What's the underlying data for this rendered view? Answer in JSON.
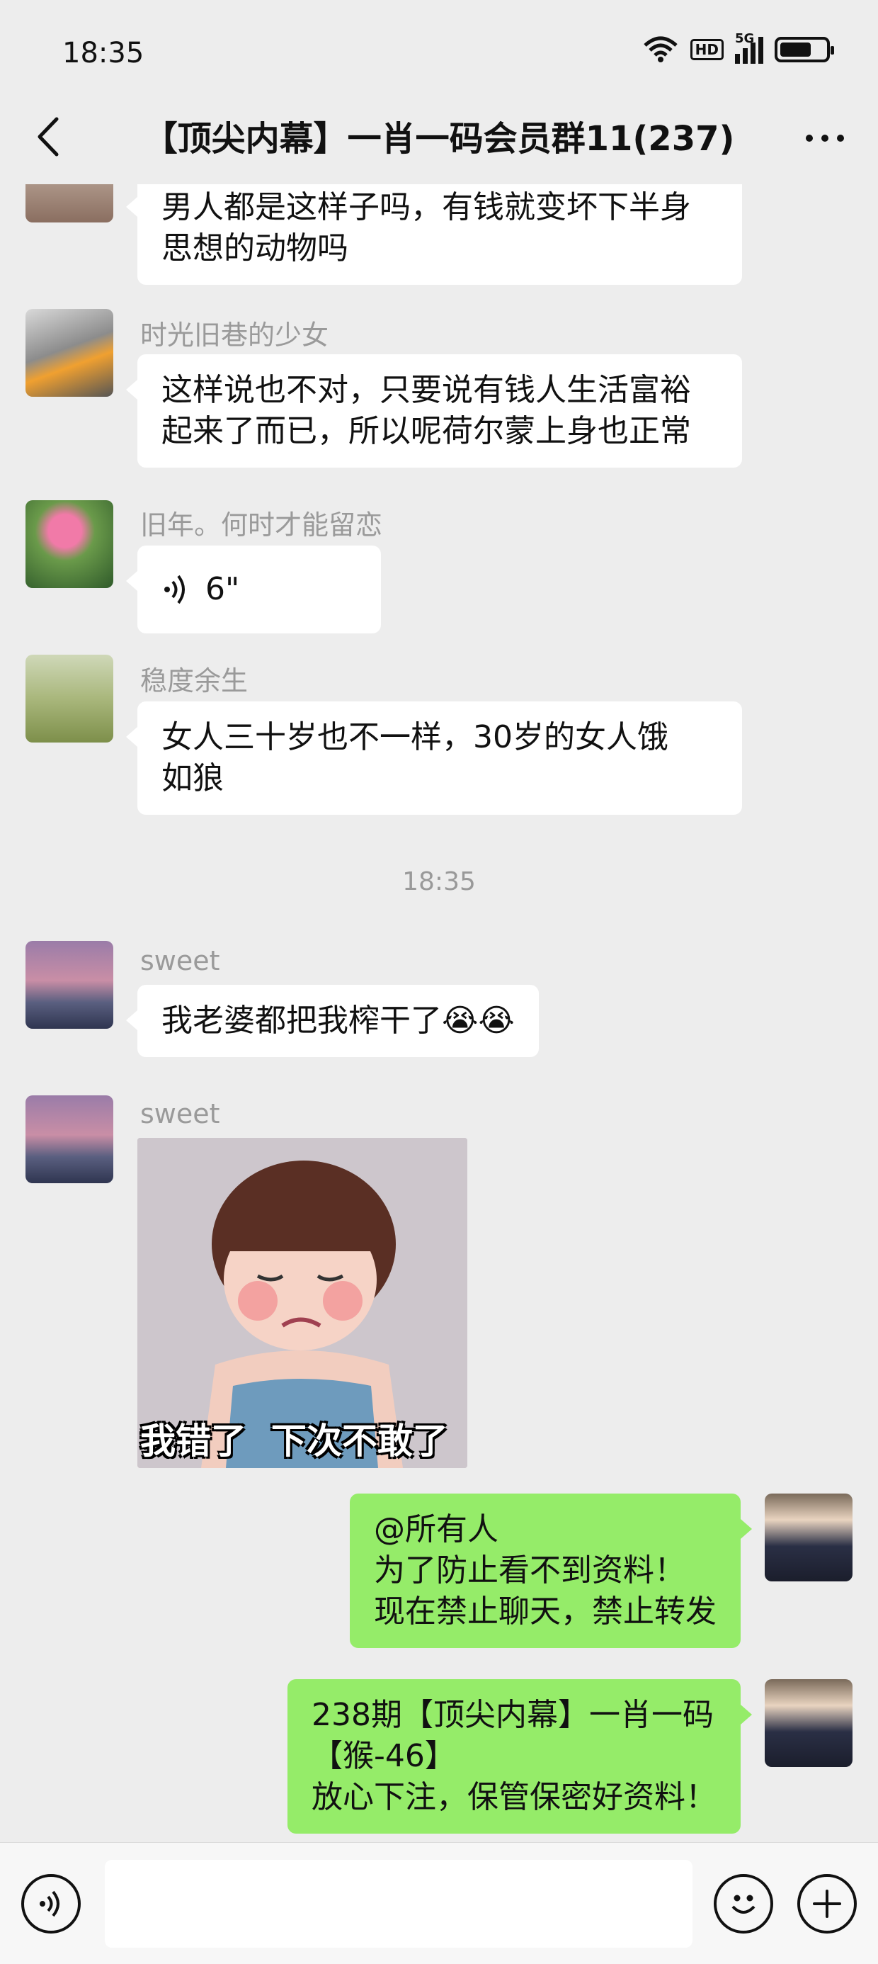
{
  "status_bar": {
    "time": "18:35",
    "hd_label": "HD",
    "network_label": "5G",
    "battery_level": 0.7
  },
  "header": {
    "title": "【顶尖内幕】一肖一码会员群11(237)"
  },
  "messages": [
    {
      "sender": "",
      "text": "男人都是这样子吗，有钱就变坏下半身\n思想的动物吗"
    },
    {
      "sender": "时光旧巷的少女",
      "text": "这样说也不对，只要说有钱人生活富裕\n起来了而已，所以呢荷尔蒙上身也正常"
    },
    {
      "sender": "旧年。何时才能留恋",
      "voice_duration": "6\""
    },
    {
      "sender": "稳度余生",
      "text": "女人三十岁也不一样，30岁的女人饿\n如狼"
    },
    {
      "sender": "sweet",
      "text": "我老婆都把我榨干了😭😭"
    },
    {
      "sender": "sweet",
      "sticker_caption": "我错了  下次不敢了"
    },
    {
      "sender": "me",
      "text": "@所有人\n为了防止看不到资料！\n现在禁止聊天，禁止转发"
    },
    {
      "sender": "me",
      "text": "238期【顶尖内幕】一肖一码\n【猴-46】\n放心下注，保管保密好资料！"
    }
  ],
  "timestamp": "18:35",
  "colors": {
    "background": "#ededed",
    "my_bubble": "#95ec69",
    "other_bubble": "#ffffff"
  },
  "icons": [
    "back-icon",
    "more-icon",
    "voice-input-icon",
    "emoji-icon",
    "add-icon",
    "wifi-icon",
    "signal-icon",
    "battery-icon"
  ]
}
